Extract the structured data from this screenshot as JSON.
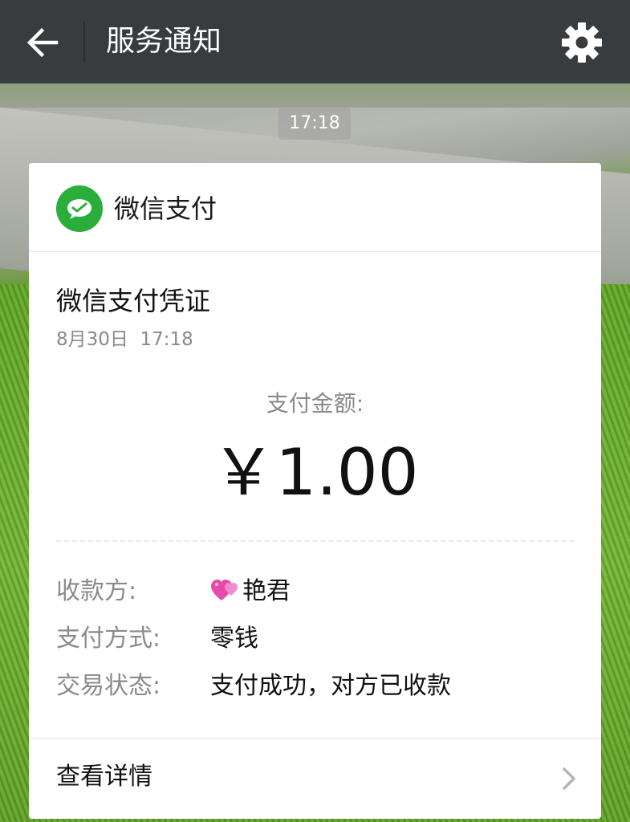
{
  "header": {
    "title": "服务通知",
    "back_icon": "back-arrow-icon",
    "settings_icon": "gear-icon"
  },
  "timestamp": "17:18",
  "card": {
    "brand_icon": "wechat-pay-icon",
    "brand_name": "微信支付",
    "voucher_title": "微信支付凭证",
    "voucher_date": "8月30日  17:18",
    "amount_label": "支付金额:",
    "amount_value": "￥1.00",
    "rows": [
      {
        "label": "收款方:",
        "value": "艳君",
        "icon": "two-hearts-emoji"
      },
      {
        "label": "支付方式:",
        "value": "零钱"
      },
      {
        "label": "交易状态:",
        "value": "支付成功，对方已收款"
      }
    ],
    "details_label": "查看详情"
  },
  "colors": {
    "topbar": "#383c3f",
    "wechat_green": "#2bad3a",
    "card": "#ffffff",
    "muted_text": "#8a8a8a"
  }
}
